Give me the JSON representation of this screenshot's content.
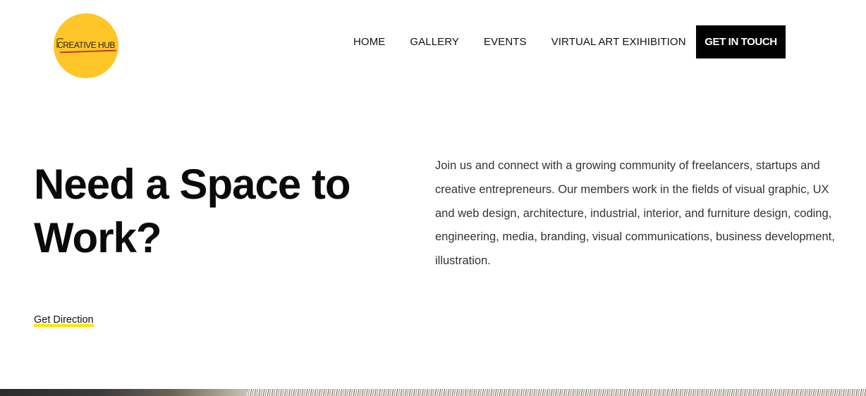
{
  "brand": {
    "logo_text": "CREATIVE HUB",
    "logo_color": "#FFC629"
  },
  "nav": {
    "items": [
      {
        "label": "HOME"
      },
      {
        "label": "GALLERY"
      },
      {
        "label": "EVENTS"
      },
      {
        "label": "VIRTUAL ART EXIHIBITION"
      }
    ],
    "cta_label": "GET IN TOUCH"
  },
  "hero": {
    "title_line1": "Need a Space to",
    "title_line2": "Work?",
    "description": "Join us and connect with a growing community of freelancers, startups and creative entrepreneurs. Our members work in the fields of visual graphic, UX and web design, architecture, industrial, interior, and furniture design, coding, engineering, media, branding, visual communications, business development, illustration.",
    "direction_link": "Get Direction",
    "accent_color": "#FFE600"
  }
}
